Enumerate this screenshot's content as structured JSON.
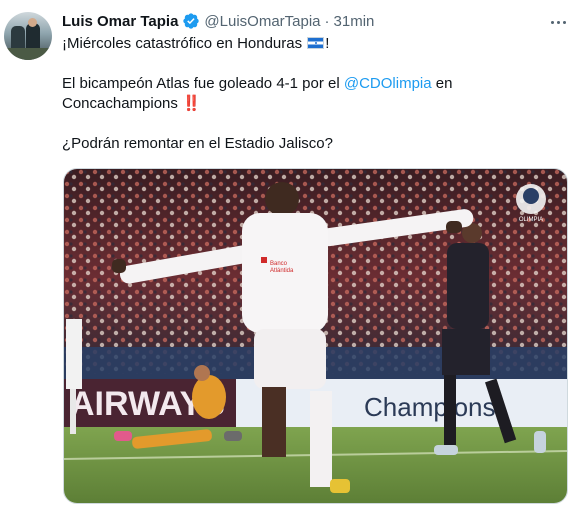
{
  "tweet": {
    "author_name": "Luis Omar Tapia",
    "author_handle": "@LuisOmarTapia",
    "separator": "·",
    "timestamp": "31min",
    "line1": "¡Miércoles catastrófico en Honduras",
    "line1_end": "!",
    "line2_start": "El bicampeón Atlas fue goleado 4-1 por el",
    "mention": "@CDOlimpia",
    "line2_end": "en",
    "line3": "Concachampions",
    "line3_emoji": "‼️",
    "line4": "¿Podrán remontar en el Estadio Jalisco?"
  },
  "photo": {
    "banner_left": "AIRWAYS",
    "banner_right": "Champions",
    "jersey_sponsor_a": "Banco",
    "jersey_sponsor_b": "Atlántida",
    "logo_text": "OLIMPIA"
  },
  "colors": {
    "accent": "#1d9bf0",
    "verified": "#1d9bf0",
    "muted": "#536471"
  },
  "icons": [
    "verified-badge-icon",
    "more-options-icon",
    "honduras-flag-icon",
    "double-exclamation-icon"
  ]
}
